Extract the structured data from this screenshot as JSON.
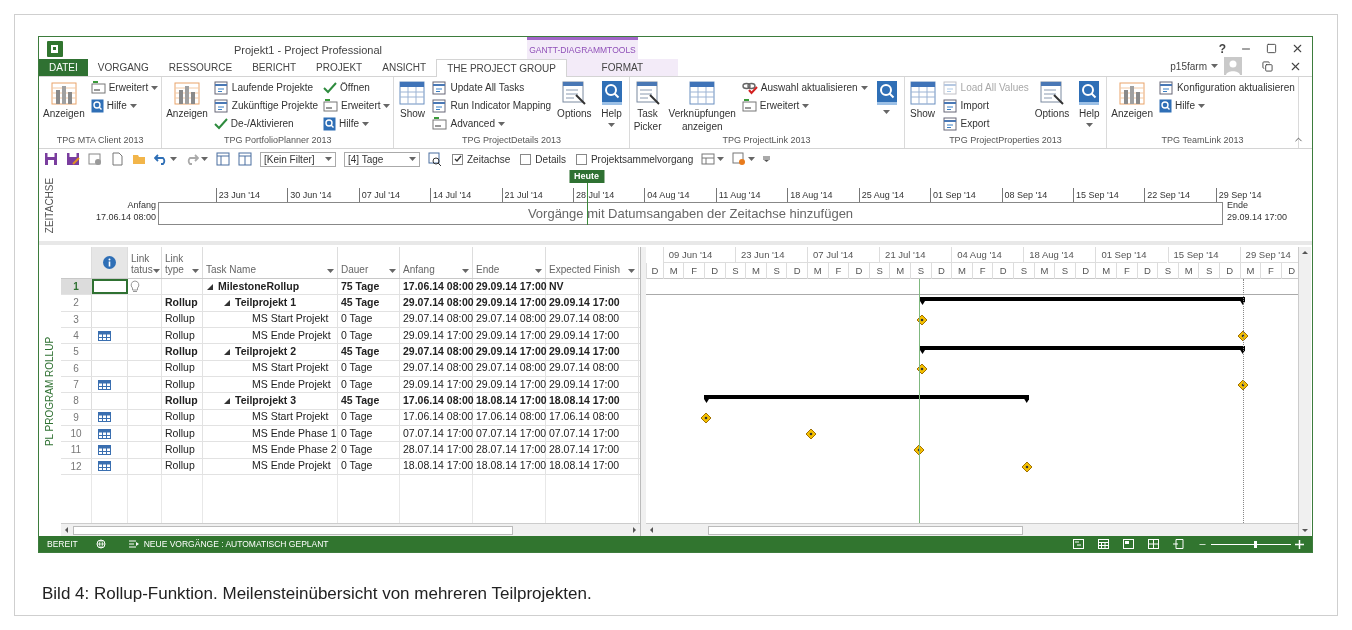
{
  "window": {
    "title": "Projekt1 - Project Professional",
    "help_label": "?",
    "user": "p15farm"
  },
  "contextual_header": "GANTT-DIAGRAMMTOOLS",
  "tabs": [
    {
      "label": "DATEI",
      "kind": "file",
      "selected": false
    },
    {
      "label": "VORGANG",
      "kind": "normal",
      "selected": false
    },
    {
      "label": "RESSOURCE",
      "kind": "normal",
      "selected": false
    },
    {
      "label": "BERICHT",
      "kind": "normal",
      "selected": false
    },
    {
      "label": "PROJEKT",
      "kind": "normal",
      "selected": false
    },
    {
      "label": "ANSICHT",
      "kind": "normal",
      "selected": false
    },
    {
      "label": "THE PROJECT GROUP",
      "kind": "normal",
      "selected": true
    },
    {
      "label": "FORMAT",
      "kind": "contextual",
      "selected": false
    }
  ],
  "ribbon_groups": [
    {
      "title": "TPG MTA Client 2013",
      "items": [
        {
          "kind": "chart",
          "lines": [
            "Anzeigen"
          ],
          "dropdown": false
        },
        {
          "kind": "stack",
          "buttons": [
            {
              "kind": "edit",
              "label": "Erweitert",
              "dropdown": true,
              "disabled": false
            },
            {
              "kind": "help",
              "label": "Hilfe",
              "dropdown": true,
              "disabled": false
            }
          ]
        }
      ]
    },
    {
      "title": "TPG PortfolioPlanner 2013",
      "items": [
        {
          "kind": "chart",
          "lines": [
            "Anzeigen"
          ],
          "dropdown": false
        },
        {
          "kind": "stack",
          "buttons": [
            {
              "kind": "doc",
              "label": "Laufende Projekte",
              "dropdown": false,
              "disabled": false
            },
            {
              "kind": "doc",
              "label": "Zukünftige Projekte",
              "dropdown": false,
              "disabled": false
            },
            {
              "kind": "check",
              "label": "De-/Aktivieren",
              "dropdown": false,
              "disabled": false
            }
          ]
        },
        {
          "kind": "stack",
          "buttons": [
            {
              "kind": "check",
              "label": "Öffnen",
              "dropdown": false,
              "disabled": false
            },
            {
              "kind": "edit",
              "label": "Erweitert",
              "dropdown": true,
              "disabled": false
            },
            {
              "kind": "help",
              "label": "Hilfe",
              "dropdown": true,
              "disabled": false
            }
          ]
        }
      ]
    },
    {
      "title": "TPG ProjectDetails 2013",
      "items": [
        {
          "kind": "table",
          "lines": [
            "Show"
          ],
          "dropdown": false
        },
        {
          "kind": "stack",
          "buttons": [
            {
              "kind": "doc",
              "label": "Update All Tasks",
              "dropdown": false,
              "disabled": false
            },
            {
              "kind": "doc",
              "label": "Run Indicator Mapping",
              "dropdown": false,
              "disabled": false
            },
            {
              "kind": "edit",
              "label": "Advanced",
              "dropdown": true,
              "disabled": false
            }
          ]
        },
        {
          "kind": "options",
          "lines": [
            "Options"
          ],
          "dropdown": false
        },
        {
          "kind": "help",
          "lines": [
            "Help"
          ],
          "dropdown": true
        }
      ]
    },
    {
      "title": "TPG ProjectLink 2013",
      "items": [
        {
          "kind": "options",
          "lines": [
            "Task",
            "Picker"
          ],
          "dropdown": false
        },
        {
          "kind": "table",
          "lines": [
            "Verknüpfungen",
            "anzeigen"
          ],
          "dropdown": false
        },
        {
          "kind": "stack",
          "buttons": [
            {
              "kind": "link",
              "label": "Auswahl aktualisieren",
              "dropdown": true,
              "disabled": false
            },
            {
              "kind": "edit",
              "label": "Erweitert",
              "dropdown": true,
              "disabled": false
            }
          ]
        },
        {
          "kind": "help",
          "dropdown": true
        }
      ]
    },
    {
      "title": "TPG ProjectProperties 2013",
      "items": [
        {
          "kind": "table",
          "lines": [
            "Show"
          ],
          "dropdown": false
        },
        {
          "kind": "stack",
          "buttons": [
            {
              "kind": "doc",
              "label": "Load All Values",
              "dropdown": false,
              "disabled": true
            },
            {
              "kind": "doc",
              "label": "Import",
              "dropdown": false,
              "disabled": false
            },
            {
              "kind": "doc",
              "label": "Export",
              "dropdown": false,
              "disabled": false
            }
          ]
        },
        {
          "kind": "options",
          "lines": [
            "Options"
          ],
          "dropdown": false
        },
        {
          "kind": "help",
          "lines": [
            "Help"
          ],
          "dropdown": true
        }
      ]
    },
    {
      "title": "TPG TeamLink 2013",
      "items": [
        {
          "kind": "chart",
          "lines": [
            "Anzeigen"
          ],
          "dropdown": false
        },
        {
          "kind": "stack",
          "buttons": [
            {
              "kind": "doc",
              "label": "Konfiguration aktualisieren",
              "dropdown": false,
              "disabled": false
            },
            {
              "kind": "help",
              "label": "Hilfe",
              "dropdown": true,
              "disabled": false
            }
          ]
        }
      ]
    }
  ],
  "qat": {
    "filter": "[Kein Filter]",
    "zoom": "[4] Tage",
    "checkboxes": [
      {
        "label": "Zeitachse",
        "checked": true
      },
      {
        "label": "Details",
        "checked": false
      },
      {
        "label": "Projektsammelvorgang",
        "checked": false
      }
    ]
  },
  "timeline": {
    "label": "ZEITACHSE",
    "start_label": "Anfang",
    "start_date": "17.06.14 08:00",
    "end_label": "Ende",
    "end_date": "29.09.14 17:00",
    "today_label": "Heute",
    "hint": "Vorgänge mit Datumsangaben der Zeitachse hinzufügen",
    "ticks": [
      "23 Jun '14",
      "30 Jun '14",
      "07 Jul '14",
      "14 Jul '14",
      "21 Jul '14",
      "28 Jul '14",
      "04 Aug '14",
      "11 Aug '14",
      "18 Aug '14",
      "25 Aug '14",
      "01 Sep '14",
      "08 Sep '14",
      "15 Sep '14",
      "22 Sep '14",
      "29 Sep '14"
    ]
  },
  "view_label": "PL PROGRAM ROLLUP",
  "columns": [
    {
      "kind": "info",
      "filter": false
    },
    {
      "kind": "text",
      "lines": [
        "Link",
        "tatus"
      ],
      "filter": true
    },
    {
      "kind": "text",
      "lines": [
        "Link",
        "type"
      ],
      "filter": true
    },
    {
      "kind": "text",
      "lines": [
        "Task Name"
      ],
      "filter": true
    },
    {
      "kind": "text",
      "lines": [
        "Dauer"
      ],
      "filter": true
    },
    {
      "kind": "text",
      "lines": [
        "Anfang"
      ],
      "filter": true
    },
    {
      "kind": "text",
      "lines": [
        "Ende"
      ],
      "filter": true
    },
    {
      "kind": "text",
      "lines": [
        "Expected Finish"
      ],
      "filter": true
    }
  ],
  "tasks": [
    {
      "id": "1",
      "kind": "project",
      "selected": true,
      "indicator": false,
      "link_status": true,
      "name": "MilestoneRollup",
      "dauer": "75 Tage",
      "anfang": "17.06.14 08:00",
      "ende": "29.09.14 17:00",
      "expected": "NV",
      "expanded": true,
      "children": [
        {
          "id": "2",
          "kind": "summary",
          "selected": false,
          "indicator": false,
          "link_status": false,
          "link_type": "Rollup",
          "name": "Teilprojekt 1",
          "dauer": "45 Tage",
          "anfang": "29.07.14 08:00",
          "ende": "29.09.14 17:00",
          "expected": "29.09.14 17:00",
          "expanded": true,
          "children": [
            {
              "id": "3",
              "kind": "milestone",
              "selected": false,
              "indicator": false,
              "link_status": false,
              "link_type": "Rollup",
              "name": "MS Start Projekt",
              "dauer": "0 Tage",
              "anfang": "29.07.14 08:00",
              "ende": "29.07.14 08:00",
              "expected": "29.07.14 08:00"
            },
            {
              "id": "4",
              "kind": "milestone",
              "selected": false,
              "indicator": true,
              "link_status": false,
              "link_type": "Rollup",
              "name": "MS Ende Projekt",
              "dauer": "0 Tage",
              "anfang": "29.09.14 17:00",
              "ende": "29.09.14 17:00",
              "expected": "29.09.14 17:00"
            }
          ]
        },
        {
          "id": "5",
          "kind": "summary",
          "selected": false,
          "indicator": false,
          "link_status": false,
          "link_type": "Rollup",
          "name": "Teilprojekt 2",
          "dauer": "45 Tage",
          "anfang": "29.07.14 08:00",
          "ende": "29.09.14 17:00",
          "expected": "29.09.14 17:00",
          "expanded": true,
          "children": [
            {
              "id": "6",
              "kind": "milestone",
              "selected": false,
              "indicator": false,
              "link_status": false,
              "link_type": "Rollup",
              "name": "MS Start Projekt",
              "dauer": "0 Tage",
              "anfang": "29.07.14 08:00",
              "ende": "29.07.14 08:00",
              "expected": "29.07.14 08:00"
            },
            {
              "id": "7",
              "kind": "milestone",
              "selected": false,
              "indicator": true,
              "link_status": false,
              "link_type": "Rollup",
              "name": "MS Ende Projekt",
              "dauer": "0 Tage",
              "anfang": "29.09.14 17:00",
              "ende": "29.09.14 17:00",
              "expected": "29.09.14 17:00"
            }
          ]
        },
        {
          "id": "8",
          "kind": "summary",
          "selected": false,
          "indicator": false,
          "link_status": false,
          "link_type": "Rollup",
          "name": "Teilprojekt 3",
          "dauer": "45 Tage",
          "anfang": "17.06.14 08:00",
          "ende": "18.08.14 17:00",
          "expected": "18.08.14 17:00",
          "expanded": true,
          "children": [
            {
              "id": "9",
              "kind": "milestone",
              "selected": false,
              "indicator": true,
              "link_status": false,
              "link_type": "Rollup",
              "name": "MS Start Projekt",
              "dauer": "0 Tage",
              "anfang": "17.06.14 08:00",
              "ende": "17.06.14 08:00",
              "expected": "17.06.14 08:00"
            },
            {
              "id": "10",
              "kind": "milestone",
              "selected": false,
              "indicator": true,
              "link_status": false,
              "link_type": "Rollup",
              "name": "MS Ende Phase 1",
              "dauer": "0 Tage",
              "anfang": "07.07.14 17:00",
              "ende": "07.07.14 17:00",
              "expected": "07.07.14 17:00"
            },
            {
              "id": "11",
              "kind": "milestone",
              "selected": false,
              "indicator": true,
              "link_status": false,
              "link_type": "Rollup",
              "name": "MS Ende Phase 2",
              "dauer": "0 Tage",
              "anfang": "28.07.14 17:00",
              "ende": "28.07.14 17:00",
              "expected": "28.07.14 17:00"
            },
            {
              "id": "12",
              "kind": "milestone",
              "selected": false,
              "indicator": true,
              "link_status": false,
              "link_type": "Rollup",
              "name": "MS Ende Projekt",
              "dauer": "0 Tage",
              "anfang": "18.08.14 17:00",
              "ende": "18.08.14 17:00",
              "expected": "18.08.14 17:00"
            }
          ]
        }
      ]
    }
  ],
  "gantt_timescale": {
    "top": [
      "09 Jun '14",
      "23 Jun '14",
      "07 Jul '14",
      "21 Jul '14",
      "04 Aug '14",
      "18 Aug '14",
      "01 Sep '14",
      "15 Sep '14",
      "29 Sep '14"
    ],
    "bottom": [
      "D",
      "M",
      "F",
      "D",
      "S",
      "M",
      "S",
      "D",
      "M",
      "F",
      "D",
      "S",
      "M",
      "S",
      "D",
      "M",
      "F",
      "D",
      "S",
      "M",
      "S",
      "D",
      "M",
      "F",
      "D",
      "S",
      "M",
      "S",
      "D",
      "M",
      "F",
      "D"
    ]
  },
  "status_bar": {
    "ready": "BEREIT",
    "mode": "NEUE VORGÄNGE : AUTOMATISCH GEPLANT",
    "zoom": {
      "level": 0.55
    }
  },
  "caption": "Bild 4: Rollup-Funktion. Meilensteinübersicht von mehreren Teilprojekten."
}
